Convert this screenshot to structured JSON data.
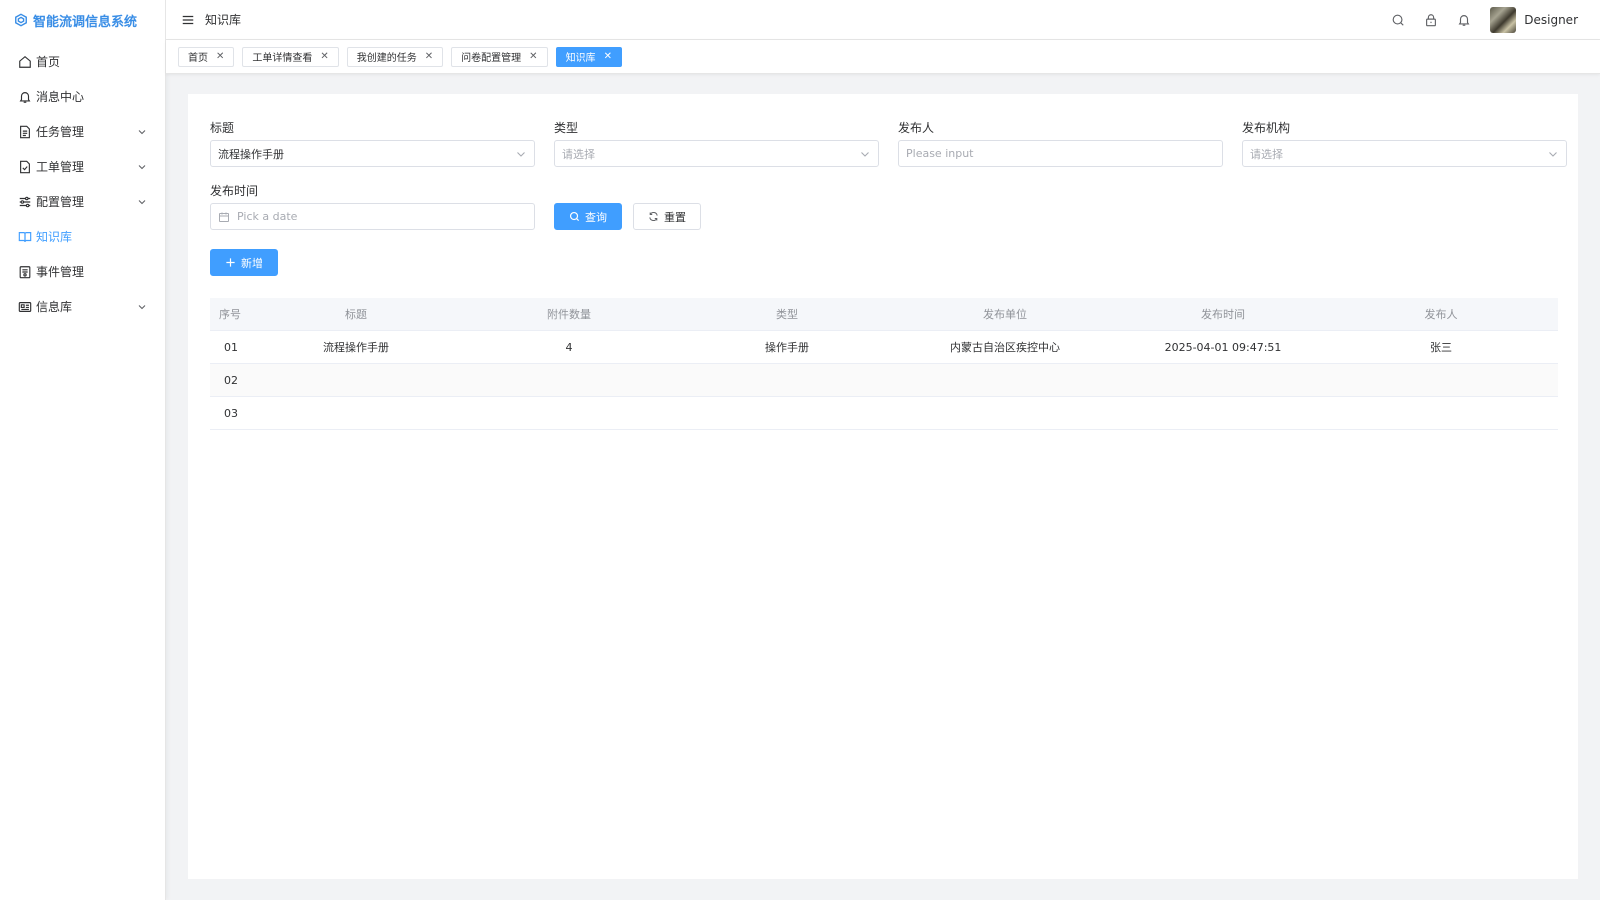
{
  "app": {
    "title": "智能流调信息系统"
  },
  "sidebar": {
    "items": [
      {
        "label": "首页",
        "icon": "home-icon",
        "expandable": false
      },
      {
        "label": "消息中心",
        "icon": "bell-icon",
        "expandable": false
      },
      {
        "label": "任务管理",
        "icon": "document-icon",
        "expandable": true
      },
      {
        "label": "工单管理",
        "icon": "file-check-icon",
        "expandable": true
      },
      {
        "label": "配置管理",
        "icon": "sliders-icon",
        "expandable": true
      },
      {
        "label": "知识库",
        "icon": "book-icon",
        "expandable": false,
        "active": true
      },
      {
        "label": "事件管理",
        "icon": "event-icon",
        "expandable": false
      },
      {
        "label": "信息库",
        "icon": "id-card-icon",
        "expandable": true
      }
    ]
  },
  "header": {
    "title": "知识库",
    "user_name": "Designer"
  },
  "tabs": [
    {
      "label": "首页",
      "active": false
    },
    {
      "label": "工单详情查看",
      "active": false
    },
    {
      "label": "我创建的任务",
      "active": false
    },
    {
      "label": "问卷配置管理",
      "active": false
    },
    {
      "label": "知识库",
      "active": true
    }
  ],
  "filters": {
    "title_label": "标题",
    "title_value": "流程操作手册",
    "type_label": "类型",
    "type_placeholder": "请选择",
    "publisher_label": "发布人",
    "publisher_placeholder": "Please input",
    "org_label": "发布机构",
    "org_placeholder": "请选择",
    "date_label": "发布时间",
    "date_placeholder": "Pick a date",
    "search_label": "查询",
    "reset_label": "重置",
    "add_label": "新增"
  },
  "table": {
    "columns": [
      "序号",
      "标题",
      "附件数量",
      "类型",
      "发布单位",
      "发布时间",
      "发布人"
    ],
    "rows": [
      [
        "01",
        "流程操作手册",
        "4",
        "操作手册",
        "内蒙古自治区疾控中心",
        "2025-04-01 09:47:51",
        "张三"
      ],
      [
        "02",
        "",
        "",
        "",
        "",
        "",
        ""
      ],
      [
        "03",
        "",
        "",
        "",
        "",
        "",
        ""
      ]
    ]
  },
  "colors": {
    "primary": "#409eff",
    "background": "#f2f3f5"
  }
}
